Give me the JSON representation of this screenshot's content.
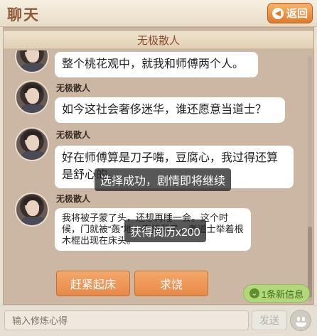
{
  "app": {
    "title": "聊天",
    "back_label": "返回"
  },
  "header": {
    "title": "无极散人"
  },
  "messages": [
    {
      "name": "",
      "text": "整个桃花观中，就我和师傅两个人。"
    },
    {
      "name": "无极散人",
      "text": "如今这社会奢侈迷华，谁还愿意当道士？"
    },
    {
      "name": "无极散人",
      "text": "好在师傅算是刀子嘴，豆腐心，我过得还算是舒心的。"
    },
    {
      "name": "无极散人",
      "text": "我将被子蒙了头，还想再睡一会。这个时候，门就被“轰”地一声撞开了，老道士举着根木棍出现在床头。"
    }
  ],
  "toasts": {
    "progress": "选择成功，剧情即将继续",
    "reward": "获得阅历x200"
  },
  "choices": [
    "赶紧起床",
    "求饶"
  ],
  "new_messages": "1条新信息",
  "input": {
    "placeholder": "输入修炼心得",
    "send_label": "发送"
  },
  "icons": {
    "back": "back-arrow-icon",
    "new": "chevron-down-icon",
    "emoji": "smiley-icon"
  },
  "colors": {
    "accent": "#e07a2c",
    "choice": "#ec9355",
    "new_badge": "#b3d77a",
    "panel": "#cbb7a3"
  }
}
